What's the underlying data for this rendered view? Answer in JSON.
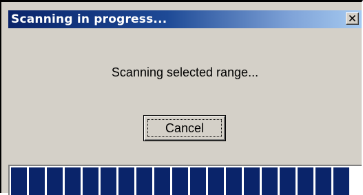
{
  "dialog": {
    "title": "Scanning in progress...",
    "close_glyph": "✕",
    "message": "Scanning selected range...",
    "cancel_label": "Cancel"
  },
  "progress": {
    "level": 1.0,
    "segment_count": 19,
    "color": "#0a246a"
  },
  "colors": {
    "titlebar_start": "#0a246a",
    "titlebar_end": "#a6caf0",
    "window_face": "#d4d0c8"
  }
}
